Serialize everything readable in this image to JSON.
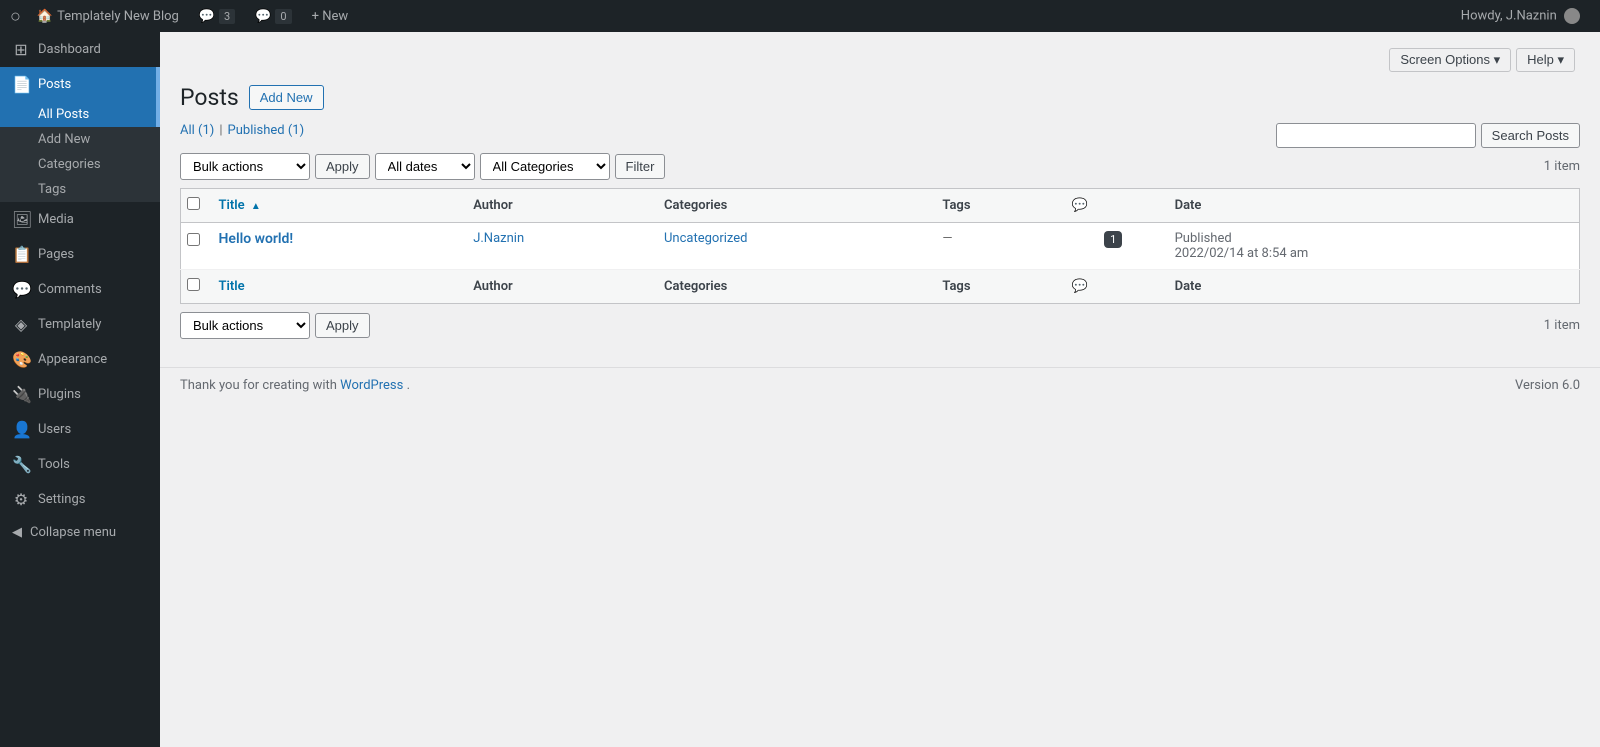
{
  "adminbar": {
    "logo": "W",
    "site_name": "Templately New Blog",
    "comments_count": "3",
    "comments_label": "3",
    "comments_pending": "0",
    "new_label": "+ New",
    "user_greeting": "Howdy, J.Naznin"
  },
  "sidebar": {
    "items": [
      {
        "id": "dashboard",
        "label": "Dashboard",
        "icon": "⊞"
      },
      {
        "id": "posts",
        "label": "Posts",
        "icon": "📄",
        "active": true
      },
      {
        "id": "media",
        "label": "Media",
        "icon": "🖼"
      },
      {
        "id": "pages",
        "label": "Pages",
        "icon": "📋"
      },
      {
        "id": "comments",
        "label": "Comments",
        "icon": "💬"
      },
      {
        "id": "templately",
        "label": "Templately",
        "icon": "◈"
      },
      {
        "id": "appearance",
        "label": "Appearance",
        "icon": "🎨"
      },
      {
        "id": "plugins",
        "label": "Plugins",
        "icon": "🔌"
      },
      {
        "id": "users",
        "label": "Users",
        "icon": "👤"
      },
      {
        "id": "tools",
        "label": "Tools",
        "icon": "🔧"
      },
      {
        "id": "settings",
        "label": "Settings",
        "icon": "⚙"
      }
    ],
    "submenu": {
      "posts": [
        {
          "label": "All Posts",
          "active": true
        },
        {
          "label": "Add New"
        },
        {
          "label": "Categories"
        },
        {
          "label": "Tags"
        }
      ]
    },
    "collapse_label": "Collapse menu"
  },
  "topbar": {
    "screen_options_label": "Screen Options",
    "help_label": "Help"
  },
  "page": {
    "title": "Posts",
    "add_new_label": "Add New"
  },
  "filters": {
    "all_label": "All",
    "all_count": "(1)",
    "published_label": "Published",
    "published_count": "(1)",
    "search_placeholder": "",
    "search_btn_label": "Search Posts",
    "bulk_actions_label": "Bulk actions",
    "all_dates_label": "All dates",
    "all_categories_label": "All Categories",
    "apply_label": "Apply",
    "filter_label": "Filter",
    "item_count_top": "1 item",
    "item_count_bottom": "1 item"
  },
  "table": {
    "columns": [
      {
        "id": "title",
        "label": "Title",
        "sortable": true
      },
      {
        "id": "author",
        "label": "Author"
      },
      {
        "id": "categories",
        "label": "Categories"
      },
      {
        "id": "tags",
        "label": "Tags"
      },
      {
        "id": "comments",
        "label": "💬"
      },
      {
        "id": "date",
        "label": "Date"
      }
    ],
    "rows": [
      {
        "id": 1,
        "title": "Hello world!",
        "author": "J.Naznin",
        "categories": "Uncategorized",
        "tags": "—",
        "comments": "1",
        "date_status": "Published",
        "date_value": "2022/02/14 at 8:54 am"
      }
    ]
  },
  "footer": {
    "thank_you_text": "Thank you for creating with ",
    "wordpress_link": "WordPress",
    "version": "Version 6.0"
  }
}
